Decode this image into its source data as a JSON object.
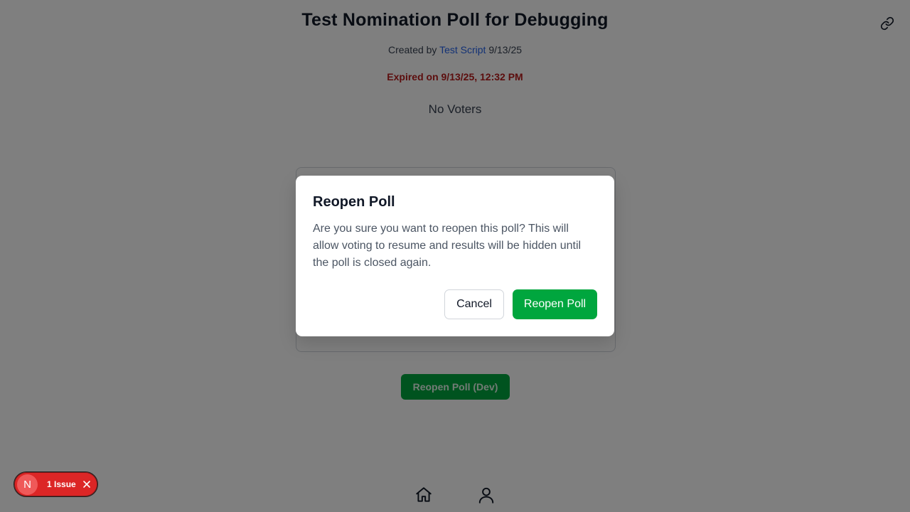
{
  "poll": {
    "title": "Test Nomination Poll for Debugging",
    "created_by_prefix": "Created by",
    "author": "Test Script",
    "created_date": "9/13/25",
    "expired_text": "Expired on 9/13/25, 12:32 PM",
    "voters_text": "No Voters",
    "dev_reopen_label": "Reopen Poll (Dev)"
  },
  "icons": {
    "share": "link-icon",
    "home": "home-icon",
    "profile": "user-icon",
    "close": "close-icon"
  },
  "dev_overlay": {
    "logo_letter": "N",
    "issues_label": "1 Issue"
  },
  "modal": {
    "title": "Reopen Poll",
    "body": "Are you sure you want to reopen this poll? This will allow voting to resume and results will be hidden until the poll is closed again.",
    "cancel_label": "Cancel",
    "confirm_label": "Reopen Poll"
  },
  "colors": {
    "accent_green": "#00a63e",
    "author_link": "#2563eb",
    "expired_red": "#b91c1c",
    "issue_badge": "#dc2626"
  }
}
